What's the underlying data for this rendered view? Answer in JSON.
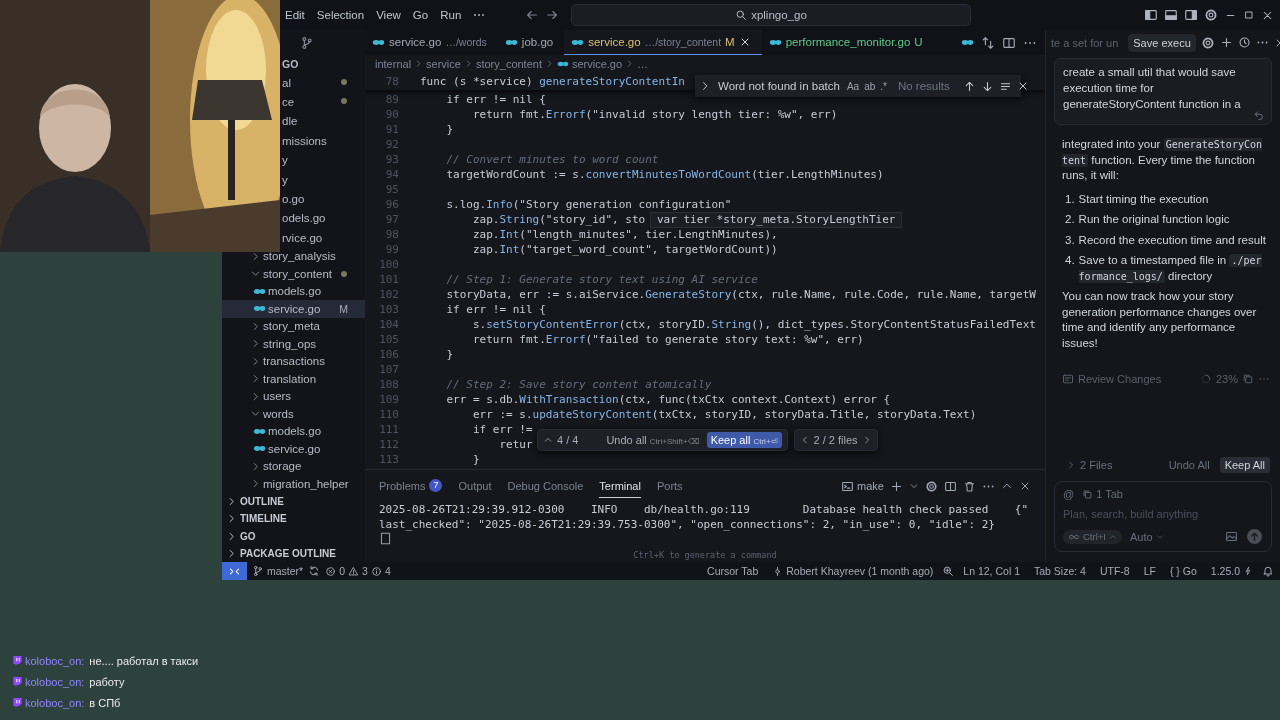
{
  "title_bar": {
    "menu": [
      "Edit",
      "Selection",
      "View",
      "Go",
      "Run",
      "⋯"
    ],
    "search": "xplingo_go"
  },
  "explorer": {
    "header": "GO",
    "items": [
      {
        "label": "al",
        "kind": "partial",
        "modified": true,
        "selected": false
      },
      {
        "label": "ce",
        "kind": "partial",
        "modified": true,
        "selected": false
      },
      {
        "label": "dle",
        "kind": "partial",
        "modified": false,
        "selected": false
      },
      {
        "label": "missions",
        "kind": "partial",
        "modified": false,
        "selected": false
      },
      {
        "label": "y",
        "kind": "partial",
        "modified": false,
        "selected": false
      },
      {
        "label": "y",
        "kind": "partial",
        "modified": false,
        "selected": false
      },
      {
        "label": "o.go",
        "kind": "partial",
        "modified": false,
        "selected": false
      },
      {
        "label": "odels.go",
        "kind": "partial",
        "modified": false,
        "selected": false
      },
      {
        "label": "rvice.go",
        "kind": "partial",
        "modified": false,
        "selected": false
      },
      {
        "label": "story_analysis",
        "kind": "folder",
        "expanded": false,
        "modified": false,
        "selected": false
      },
      {
        "label": "story_content",
        "kind": "folder",
        "expanded": true,
        "modified": true,
        "selected": false,
        "children": [
          {
            "label": "models.go",
            "kind": "file",
            "modified": false,
            "selected": false
          },
          {
            "label": "service.go",
            "kind": "file",
            "modified": false,
            "selected": true,
            "status": "M"
          }
        ]
      },
      {
        "label": "story_meta",
        "kind": "folder",
        "expanded": false,
        "modified": false,
        "selected": false
      },
      {
        "label": "string_ops",
        "kind": "folder",
        "expanded": false,
        "modified": false,
        "selected": false
      },
      {
        "label": "transactions",
        "kind": "folder",
        "expanded": false,
        "modified": false,
        "selected": false
      },
      {
        "label": "translation",
        "kind": "folder",
        "expanded": false,
        "modified": false,
        "selected": false
      },
      {
        "label": "users",
        "kind": "folder",
        "expanded": false,
        "modified": false,
        "selected": false
      },
      {
        "label": "words",
        "kind": "folder",
        "expanded": true,
        "modified": false,
        "selected": false,
        "children": [
          {
            "label": "models.go",
            "kind": "file",
            "modified": false,
            "selected": false
          },
          {
            "label": "service.go",
            "kind": "file",
            "modified": false,
            "selected": false
          }
        ]
      },
      {
        "label": "storage",
        "kind": "folder",
        "expanded": false,
        "modified": false,
        "selected": false
      },
      {
        "label": "migration_helper",
        "kind": "folder",
        "expanded": false,
        "modified": false,
        "selected": false
      }
    ],
    "sections": [
      {
        "label": "OUTLINE",
        "expanded": false
      },
      {
        "label": "TIMELINE",
        "expanded": false
      },
      {
        "label": "GO",
        "expanded": false
      },
      {
        "label": "PACKAGE OUTLINE",
        "expanded": false
      }
    ]
  },
  "editor": {
    "tabs": [
      {
        "label": "service.go",
        "path": "…/words",
        "modified": false,
        "untracked": false,
        "selected": false
      },
      {
        "label": "job.go",
        "modified": false,
        "untracked": false,
        "selected": false
      },
      {
        "label": "service.go",
        "path": "…/story_content",
        "status": "M",
        "modified": true,
        "untracked": false,
        "selected": true
      },
      {
        "label": "performance_monitor.go",
        "status": "U",
        "modified": false,
        "untracked": true,
        "selected": false
      }
    ],
    "breadcrumbs": [
      {
        "label": "internal",
        "kind": "folder"
      },
      {
        "label": "service",
        "kind": "folder"
      },
      {
        "label": "story_content",
        "kind": "folder"
      },
      {
        "label": "service.go",
        "kind": "file"
      },
      {
        "label": "…",
        "kind": "more"
      }
    ],
    "sticky_line": {
      "number": "78",
      "tokens": [
        {
          "text": "func (s *service) ",
          "kind": "plain"
        },
        {
          "text": "generateStoryContentIn",
          "kind": "fn"
        }
      ]
    },
    "lines": [
      {
        "number": "89",
        "tokens": [
          {
            "text": "    if err != nil {",
            "kind": "plain"
          }
        ]
      },
      {
        "number": "90",
        "tokens": [
          {
            "text": "        return fmt.",
            "kind": "plain"
          },
          {
            "text": "Errorf",
            "kind": "fn"
          },
          {
            "text": "(\"invalid story length tier: %w\", err)",
            "kind": "plain"
          }
        ]
      },
      {
        "number": "91",
        "tokens": [
          {
            "text": "    }",
            "kind": "plain"
          }
        ]
      },
      {
        "number": "92"
      },
      {
        "number": "93",
        "tokens": [
          {
            "text": "    // Convert minutes to word count",
            "kind": "comment"
          }
        ]
      },
      {
        "number": "94",
        "tokens": [
          {
            "text": "    targetWordCount := s.",
            "kind": "plain"
          },
          {
            "text": "convertMinutesToWordCount",
            "kind": "fn"
          },
          {
            "text": "(tier.LengthMinutes)",
            "kind": "plain"
          }
        ]
      },
      {
        "number": "95"
      },
      {
        "number": "96",
        "tokens": [
          {
            "text": "    s.log.",
            "kind": "plain"
          },
          {
            "text": "Info",
            "kind": "fn"
          },
          {
            "text": "(\"Story generation configuration\"",
            "kind": "plain"
          }
        ]
      },
      {
        "number": "97",
        "tokens": [
          {
            "text": "        zap.",
            "kind": "plain"
          },
          {
            "text": "String",
            "kind": "fn"
          },
          {
            "text": "(\"story_id\", sto",
            "kind": "plain"
          }
        ]
      },
      {
        "number": "98",
        "tokens": [
          {
            "text": "        zap.",
            "kind": "plain"
          },
          {
            "text": "Int",
            "kind": "fn"
          },
          {
            "text": "(\"length_minutes\", tier.LengthMinutes),",
            "kind": "plain"
          }
        ]
      },
      {
        "number": "99",
        "tokens": [
          {
            "text": "        zap.",
            "kind": "plain"
          },
          {
            "text": "Int",
            "kind": "fn"
          },
          {
            "text": "(\"target_word_count\", targetWordCount))",
            "kind": "plain"
          }
        ]
      },
      {
        "number": "100"
      },
      {
        "number": "101",
        "tokens": [
          {
            "text": "    // Step 1: Generate story text using AI service",
            "kind": "comment"
          }
        ]
      },
      {
        "number": "102",
        "tokens": [
          {
            "text": "    storyData, err := s.aiService.",
            "kind": "plain"
          },
          {
            "text": "GenerateStory",
            "kind": "fn"
          },
          {
            "text": "(ctx, rule.Name, rule.Code, rule.Name, targetW",
            "kind": "plain"
          }
        ]
      },
      {
        "number": "103",
        "tokens": [
          {
            "text": "    if err != nil {",
            "kind": "plain"
          }
        ]
      },
      {
        "number": "104",
        "tokens": [
          {
            "text": "        s.",
            "kind": "plain"
          },
          {
            "text": "setStoryContentError",
            "kind": "fn"
          },
          {
            "text": "(ctx, storyID.",
            "kind": "plain"
          },
          {
            "text": "String",
            "kind": "fn"
          },
          {
            "text": "(), dict_types.StoryContentStatusFailedText",
            "kind": "plain"
          }
        ]
      },
      {
        "number": "105",
        "tokens": [
          {
            "text": "        return fmt.",
            "kind": "plain"
          },
          {
            "text": "Errorf",
            "kind": "fn"
          },
          {
            "text": "(\"failed to generate story text: %w\", err)",
            "kind": "plain"
          }
        ]
      },
      {
        "number": "106",
        "tokens": [
          {
            "text": "    }",
            "kind": "plain"
          }
        ]
      },
      {
        "number": "107"
      },
      {
        "number": "108",
        "tokens": [
          {
            "text": "    // Step 2: Save story content atomically",
            "kind": "comment"
          }
        ]
      },
      {
        "number": "109",
        "tokens": [
          {
            "text": "    err = s.db.",
            "kind": "plain"
          },
          {
            "text": "WithTransaction",
            "kind": "fn"
          },
          {
            "text": "(ctx, func(txCtx context.Context) error {",
            "kind": "plain"
          }
        ]
      },
      {
        "number": "110",
        "tokens": [
          {
            "text": "        err := s.",
            "kind": "plain"
          },
          {
            "text": "updateStoryContent",
            "kind": "fn"
          },
          {
            "text": "(txCtx, storyID, storyData.Title, storyData.Text)",
            "kind": "plain"
          }
        ]
      },
      {
        "number": "111",
        "tokens": [
          {
            "text": "        if err !=",
            "kind": "plain"
          }
        ]
      },
      {
        "number": "112",
        "tokens": [
          {
            "text": "            retur",
            "kind": "plain"
          }
        ]
      },
      {
        "number": "113",
        "tokens": [
          {
            "text": "        }",
            "kind": "plain"
          }
        ]
      }
    ],
    "find": {
      "query": "Word not found in batch",
      "options": [
        "Aa",
        "ab",
        ".*"
      ],
      "result": "No results"
    },
    "hover": "var tier *story_meta.StoryLengthTier",
    "review_bar": {
      "counter": "4 / 4",
      "undo": {
        "label": "Undo all",
        "shortcut": "Ctrl+Shift+⌫"
      },
      "keep": {
        "label": "Keep all",
        "shortcut": "Ctrl+⏎"
      },
      "files": "2 / 2 files"
    }
  },
  "panel": {
    "tabs": [
      {
        "label": "Problems",
        "badge": "7",
        "selected": false
      },
      {
        "label": "Output",
        "selected": false
      },
      {
        "label": "Debug Console",
        "selected": false
      },
      {
        "label": "Terminal",
        "selected": true
      },
      {
        "label": "Ports",
        "selected": false
      }
    ],
    "profile": "make",
    "lines": [
      "2025-08-26T21:29:39.912-0300    INFO    db/health.go:119        Database health check passed    {\"",
      "last_checked\": \"2025-08-26T21:29:39.753-0300\", \"open_connections\": 2, \"in_use\": 0, \"idle\": 2}"
    ],
    "hint": "Ctrl+K to generate a command"
  },
  "chat": {
    "tabs": [
      {
        "label": "te a set for un",
        "selected": false
      },
      {
        "label": "Save execu",
        "selected": true
      }
    ],
    "prompt": "create a small util that would save execution time for generateStoryContent function in a",
    "response": [
      {
        "kind": "paragraph",
        "parts": [
          {
            "text": "integrated into your ",
            "kind": "text"
          },
          {
            "text": "GenerateStoryContent",
            "kind": "code"
          },
          {
            "text": " function. Every time the function runs, it will:",
            "kind": "text"
          }
        ]
      },
      {
        "kind": "list",
        "items": [
          {
            "number": "1.",
            "parts": [
              {
                "text": "Start timing the execution",
                "kind": "text"
              }
            ]
          },
          {
            "number": "2.",
            "parts": [
              {
                "text": "Run the original function logic",
                "kind": "text"
              }
            ]
          },
          {
            "number": "3.",
            "parts": [
              {
                "text": "Record the execution time and result",
                "kind": "text"
              }
            ]
          },
          {
            "number": "4.",
            "parts": [
              {
                "text": "Save to a timestamped file in ",
                "kind": "text"
              },
              {
                "text": "./performance_logs/",
                "kind": "code"
              },
              {
                "text": " directory",
                "kind": "text"
              }
            ]
          }
        ]
      },
      {
        "kind": "paragraph",
        "parts": [
          {
            "text": "You can now track how your story generation performance changes over time and identify any performance issues!",
            "kind": "text"
          }
        ]
      }
    ],
    "review": {
      "label": "Review Changes",
      "progress": "23%"
    },
    "files": {
      "label": "2 Files",
      "undo": "Undo All",
      "keep": "Keep All"
    },
    "input": {
      "mention": "@",
      "context": "1 Tab",
      "placeholder": "Plan, search, build anything",
      "shortcut": "Ctrl+I",
      "model": "Auto"
    }
  },
  "status_bar": {
    "branch": "master*",
    "errors": "0",
    "warnings": "3",
    "infos": "4",
    "right": [
      {
        "kind": "plain",
        "text": "Cursor Tab"
      },
      {
        "kind": "blame",
        "text": "Robert Khayreev (1 month ago)"
      },
      {
        "kind": "zoom"
      },
      {
        "kind": "plain",
        "text": "Ln 12, Col 1"
      },
      {
        "kind": "plain",
        "text": "Tab Size: 4"
      },
      {
        "kind": "plain",
        "text": "UTF-8"
      },
      {
        "kind": "plain",
        "text": "LF"
      },
      {
        "kind": "plain",
        "text": "{ } Go"
      },
      {
        "kind": "version",
        "text": "1.25.0"
      },
      {
        "kind": "bell"
      }
    ]
  },
  "stream_chat": [
    {
      "user": "koloboc_on:",
      "message": "не.... работал в такси"
    },
    {
      "user": "koloboc_on:",
      "message": "работу"
    },
    {
      "user": "koloboc_on:",
      "message": "в СПб"
    }
  ]
}
